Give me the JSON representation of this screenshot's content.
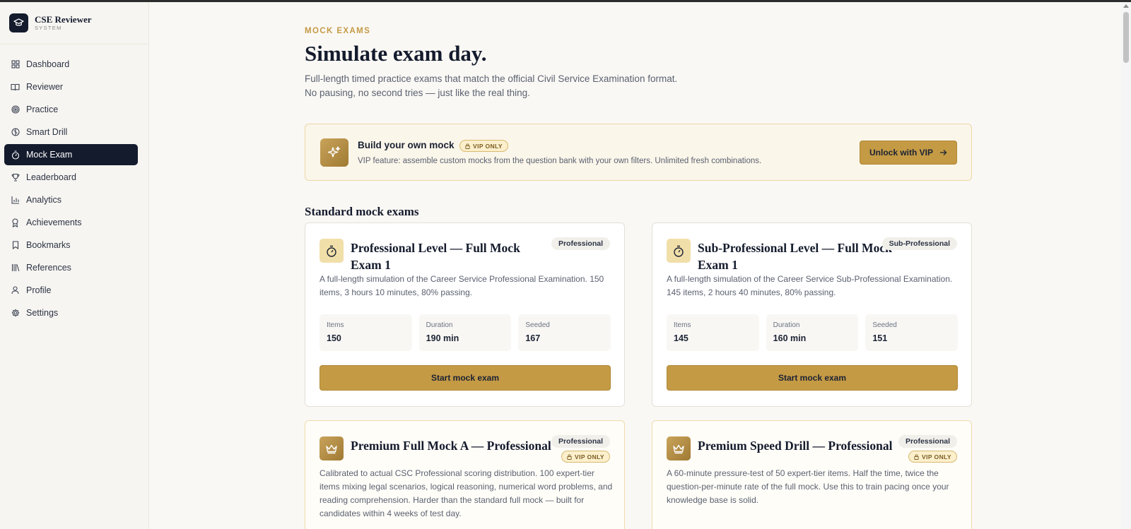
{
  "brand": {
    "title": "CSE Reviewer",
    "subtitle": "SYSTEM",
    "icon": "graduation-cap-icon"
  },
  "sidebar": {
    "items": [
      {
        "label": "Dashboard",
        "icon": "grid-icon",
        "active": false
      },
      {
        "label": "Reviewer",
        "icon": "book-open-icon",
        "active": false
      },
      {
        "label": "Practice",
        "icon": "target-icon",
        "active": false
      },
      {
        "label": "Smart Drill",
        "icon": "brain-icon",
        "active": false
      },
      {
        "label": "Mock Exam",
        "icon": "timer-icon",
        "active": true
      },
      {
        "label": "Leaderboard",
        "icon": "trophy-icon",
        "active": false
      },
      {
        "label": "Analytics",
        "icon": "bar-chart-icon",
        "active": false
      },
      {
        "label": "Achievements",
        "icon": "award-icon",
        "active": false
      },
      {
        "label": "Bookmarks",
        "icon": "bookmark-icon",
        "active": false
      },
      {
        "label": "References",
        "icon": "library-icon",
        "active": false
      },
      {
        "label": "Profile",
        "icon": "user-icon",
        "active": false
      },
      {
        "label": "Settings",
        "icon": "gear-icon",
        "active": false
      }
    ]
  },
  "header": {
    "eyebrow": "MOCK EXAMS",
    "title": "Simulate exam day.",
    "desc_line1": "Full-length timed practice exams that match the official Civil Service Examination format.",
    "desc_line2": "No pausing, no second tries — just like the real thing."
  },
  "vip_banner": {
    "title": "Build your own mock",
    "pill": "VIP ONLY",
    "desc": "VIP feature: assemble custom mocks from the question bank with your own filters. Unlimited fresh combinations.",
    "button": "Unlock with VIP",
    "icon": "sparkles-icon"
  },
  "section_title": "Standard mock exams",
  "standard_cards": [
    {
      "title": "Professional Level — Full Mock Exam 1",
      "tag": "Professional",
      "desc": "A full-length simulation of the Career Service Professional Examination. 150 items, 3 hours 10 minutes, 80% passing.",
      "stats": [
        {
          "label": "Items",
          "value": "150"
        },
        {
          "label": "Duration",
          "value": "190 min"
        },
        {
          "label": "Seeded",
          "value": "167"
        }
      ],
      "button": "Start mock exam"
    },
    {
      "title": "Sub-Professional Level — Full Mock Exam 1",
      "tag": "Sub-Professional",
      "desc": "A full-length simulation of the Career Service Sub-Professional Examination. 145 items, 2 hours 40 minutes, 80% passing.",
      "stats": [
        {
          "label": "Items",
          "value": "145"
        },
        {
          "label": "Duration",
          "value": "160 min"
        },
        {
          "label": "Seeded",
          "value": "151"
        }
      ],
      "button": "Start mock exam"
    }
  ],
  "premium_cards": [
    {
      "title": "Premium Full Mock A — Professional",
      "tag": "Professional",
      "vip": "VIP ONLY",
      "desc": "Calibrated to actual CSC Professional scoring distribution. 100 expert-tier items mixing legal scenarios, logical reasoning, numerical word problems, and reading comprehension. Harder than the standard full mock — built for candidates within 4 weeks of test day."
    },
    {
      "title": "Premium Speed Drill — Professional",
      "tag": "Professional",
      "vip": "VIP ONLY",
      "desc": "A 60-minute pressure-test of 50 expert-tier items. Half the time, twice the question-per-minute rate of the full mock. Use this to train pacing once your knowledge base is solid."
    }
  ],
  "colors": {
    "accent": "#c49a45",
    "sidebar_active": "#141b2d",
    "background": "#faf8f4"
  }
}
